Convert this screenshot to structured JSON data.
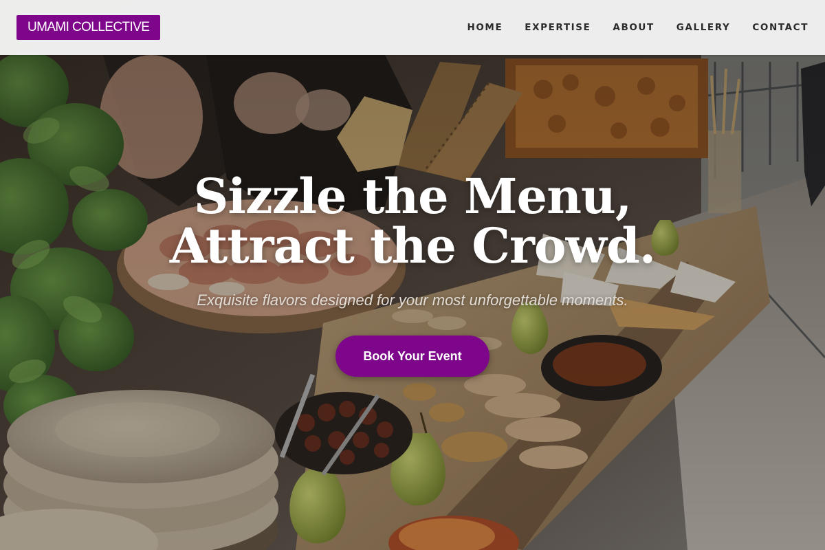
{
  "brand": {
    "name": "UMAMI COLLECTIVE",
    "accent_color": "#7d068a"
  },
  "nav": {
    "items": [
      {
        "label": "HOME"
      },
      {
        "label": "EXPERTISE"
      },
      {
        "label": "ABOUT"
      },
      {
        "label": "GALLERY"
      },
      {
        "label": "CONTACT"
      }
    ]
  },
  "hero": {
    "background": "catering-grazing-table-photo",
    "headline": "Sizzle the Menu, Attract the Crowd.",
    "subheadline": "Exquisite flavors designed for your most unforgettable moments.",
    "cta_label": "Book Your Event"
  }
}
